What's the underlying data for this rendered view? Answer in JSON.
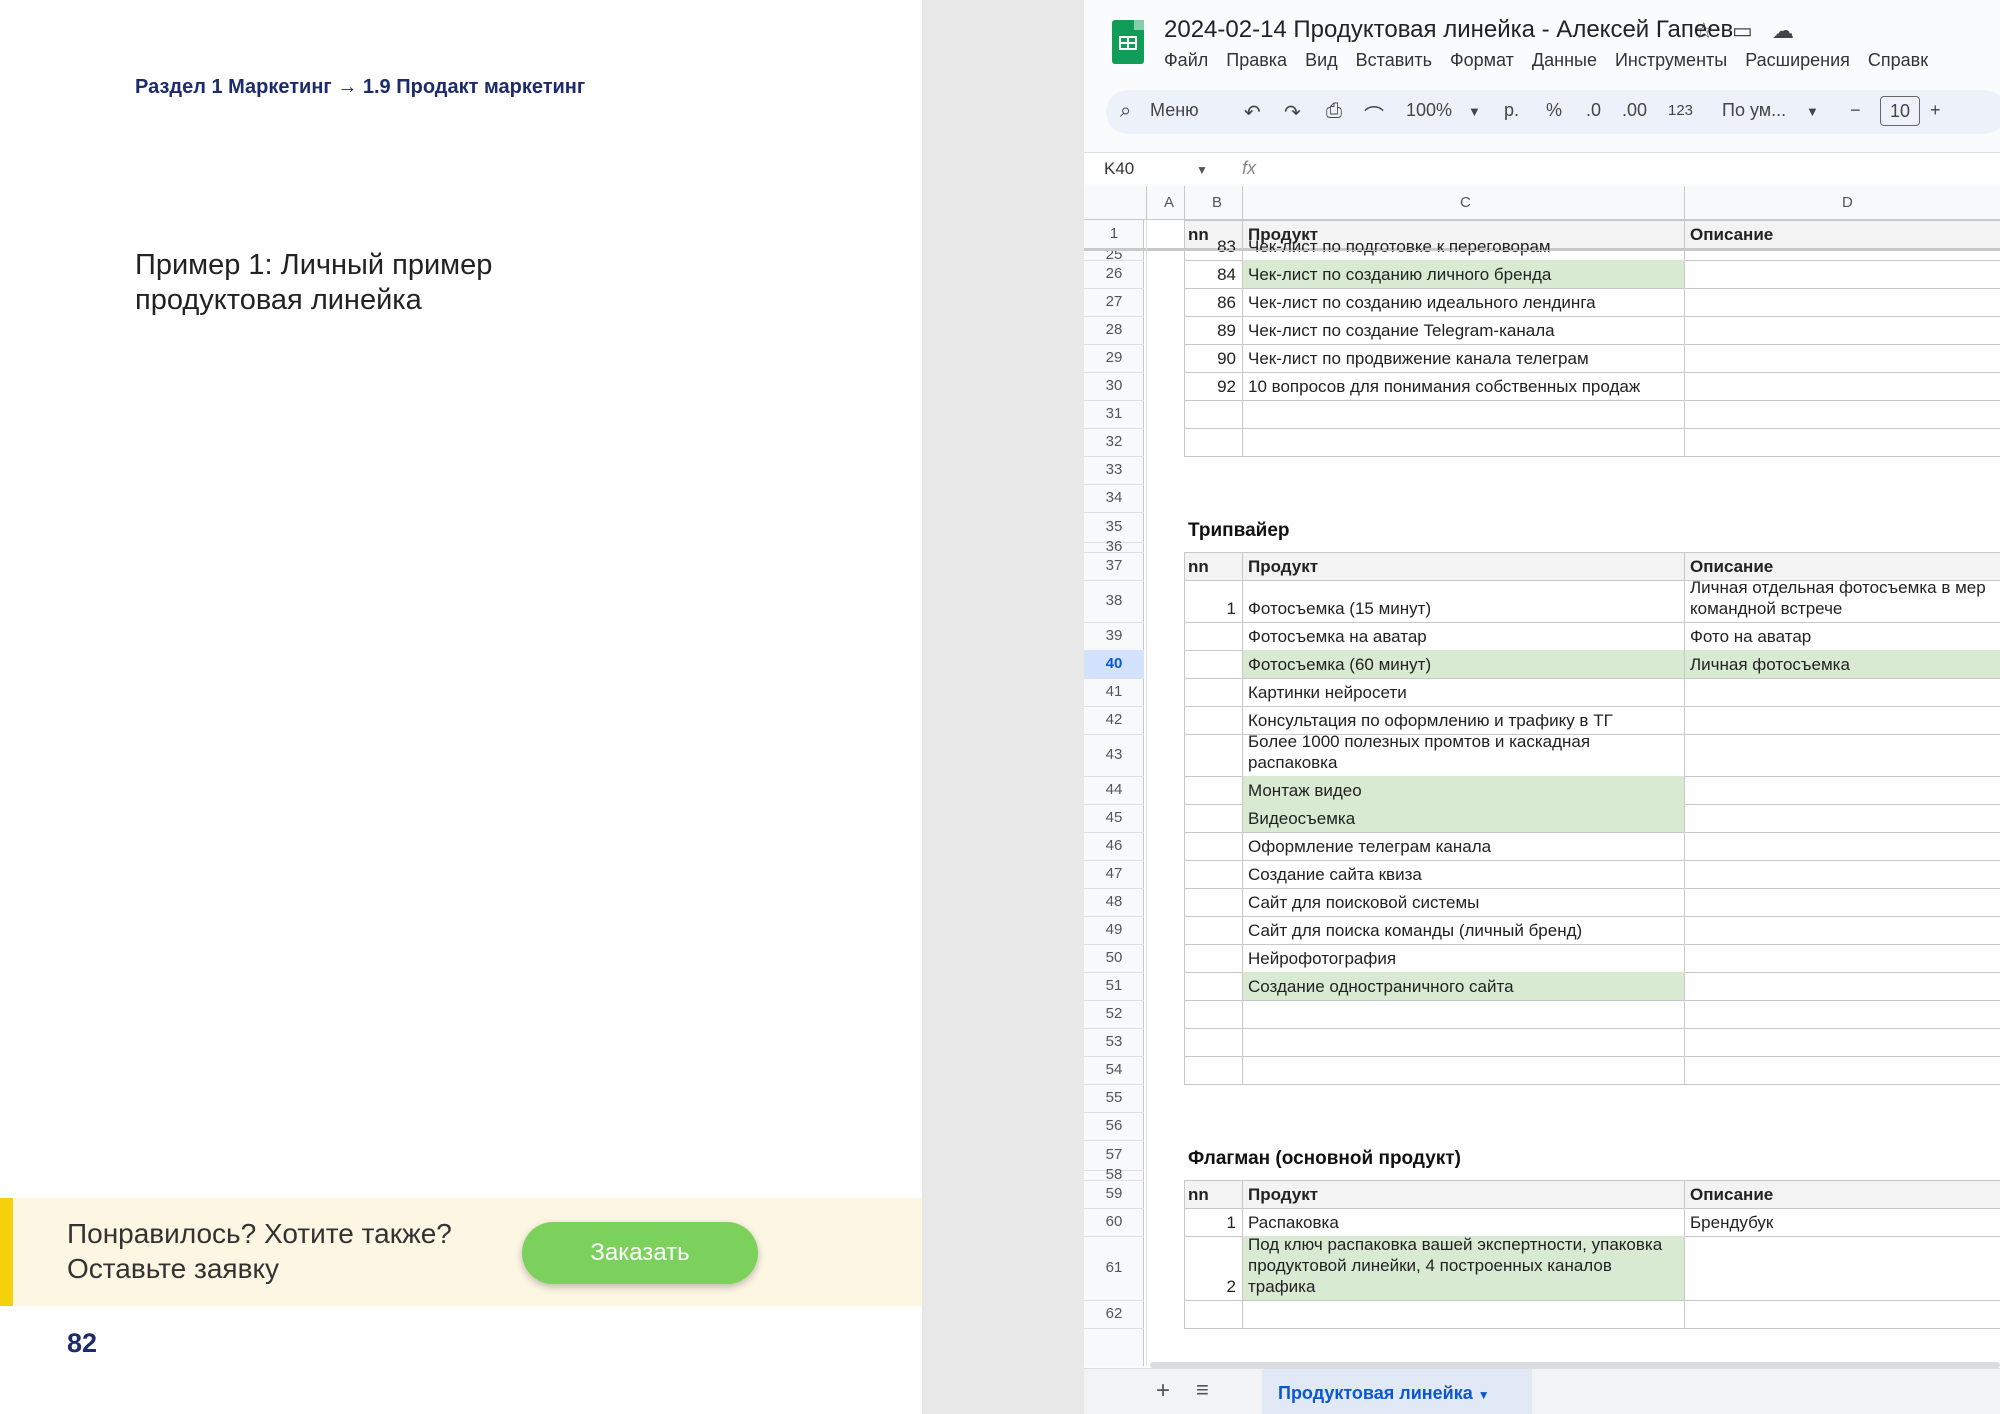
{
  "document": {
    "breadcrumb": "Раздел 1 Маркетинг  → 1.9 Продакт маркетинг",
    "example_title": "Пример 1: Личный пример продуктовая линейка",
    "cta_text": "Понравилось? Хотите также? Оставьте заявку",
    "order_button": "Заказать",
    "page_number": "82"
  },
  "spreadsheet": {
    "title": "2024-02-14 Продуктовая линейка - Алексей Гапеев",
    "menu": [
      "Файл",
      "Правка",
      "Вид",
      "Вставить",
      "Формат",
      "Данные",
      "Инструменты",
      "Расширения",
      "Справк"
    ],
    "toolbar": {
      "menu_search": "Меню",
      "zoom": "100%",
      "currency": "р.",
      "percent": "%",
      "dec_decrease": ".0",
      "dec_increase": ".00",
      "number_format": "123",
      "font": "По ум...",
      "font_size": "10"
    },
    "cell_ref": "K40",
    "fx": "fx",
    "columns": [
      "A",
      "B",
      "C",
      "D"
    ],
    "sheet_tab": "Продуктовая линейка",
    "header_row": {
      "num": "1",
      "nn": "nn",
      "product": "Продукт",
      "desc": "Описание"
    },
    "rows_part1": [
      {
        "num": "25",
        "nn": "83",
        "product": "Чек-лист по подготовке к переговорам",
        "desc": ""
      },
      {
        "num": "26",
        "nn": "84",
        "product": "Чек-лист по созданию личного бренда",
        "desc": "",
        "green": true
      },
      {
        "num": "27",
        "nn": "86",
        "product": "Чек-лист по созданию идеального лендинга",
        "desc": ""
      },
      {
        "num": "28",
        "nn": "89",
        "product": "Чек-лист по создание Telegram-канала",
        "desc": ""
      },
      {
        "num": "29",
        "nn": "90",
        "product": "Чек-лист по продвижение канала телеграм",
        "desc": ""
      },
      {
        "num": "30",
        "nn": "92",
        "product": "10 вопросов для понимания собственных продаж",
        "desc": ""
      },
      {
        "num": "31",
        "nn": "",
        "product": "",
        "desc": ""
      },
      {
        "num": "32",
        "nn": "",
        "product": "",
        "desc": ""
      }
    ],
    "tripwire_title": "Трипвайер",
    "flagship_title": "Флагман (основной продукт)",
    "tripwire_rows": [
      {
        "num": "38",
        "nn": "1",
        "product": "Фотосъемка (15 минут)",
        "desc": "Личная отдельная фотосъемка в мер|командной встрече"
      },
      {
        "num": "39",
        "nn": "",
        "product": "Фотосъемка на аватар",
        "desc": "Фото на аватар"
      },
      {
        "num": "40",
        "nn": "",
        "product": "Фотосъемка (60 минут)",
        "desc": "Личная фотосъемка",
        "green": true
      },
      {
        "num": "41",
        "nn": "",
        "product": "Картинки нейросети",
        "desc": ""
      },
      {
        "num": "42",
        "nn": "",
        "product": "Консультация по оформлению и трафику в ТГ",
        "desc": ""
      },
      {
        "num": "43",
        "nn": "",
        "product": "Более 1000 полезных промтов и каскадная|распаковка",
        "desc": ""
      },
      {
        "num": "44",
        "nn": "",
        "product": "Монтаж видео",
        "desc": "",
        "green": true
      },
      {
        "num": "45",
        "nn": "",
        "product": "Видеосъемка",
        "desc": "",
        "green": true
      },
      {
        "num": "46",
        "nn": "",
        "product": "Оформление телеграм канала",
        "desc": ""
      },
      {
        "num": "47",
        "nn": "",
        "product": "Создание сайта квиза",
        "desc": ""
      },
      {
        "num": "48",
        "nn": "",
        "product": "Сайт для поисковой системы",
        "desc": ""
      },
      {
        "num": "49",
        "nn": "",
        "product": "Сайт для поиска команды (личный бренд)",
        "desc": ""
      },
      {
        "num": "50",
        "nn": "",
        "product": "Нейрофотография",
        "desc": ""
      },
      {
        "num": "51",
        "nn": "",
        "product": "Создание одностраничного сайта",
        "desc": "",
        "green": true
      },
      {
        "num": "52",
        "nn": "",
        "product": "",
        "desc": ""
      },
      {
        "num": "53",
        "nn": "",
        "product": "",
        "desc": ""
      },
      {
        "num": "54",
        "nn": "",
        "product": "",
        "desc": ""
      }
    ],
    "flagship_rows": [
      {
        "num": "60",
        "nn": "1",
        "product": "Распаковка",
        "desc": "Брендубук"
      },
      {
        "num": "61",
        "nn": "2",
        "product": "Под ключ распаковка вашей экспертности, упаковка|продуктовой линейки, 4 построенных каналов|трафика",
        "desc": "",
        "green": true
      },
      {
        "num": "62",
        "nn": "",
        "product": "",
        "desc": ""
      }
    ],
    "extra_rownums": [
      "33",
      "34",
      "35",
      "36",
      "37",
      "55",
      "56",
      "57",
      "58",
      "59"
    ]
  }
}
